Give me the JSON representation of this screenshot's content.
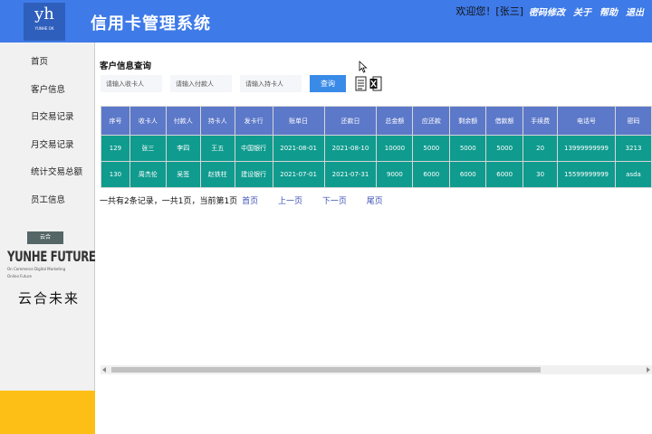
{
  "header": {
    "logo_text": "yh",
    "logo_sub": "YUNHE OK",
    "title": "信用卡管理系统",
    "welcome": "欢迎您！[张三]",
    "links": [
      "密码修改",
      "关于",
      "帮助",
      "退出"
    ]
  },
  "sidebar": {
    "items": [
      {
        "label": "首页"
      },
      {
        "label": "客户信息"
      },
      {
        "label": "日交易记录"
      },
      {
        "label": "月交易记录"
      },
      {
        "label": "统计交易总额"
      },
      {
        "label": "员工信息"
      }
    ],
    "brand": {
      "tag": "云合",
      "en": "YUNHE FUTURE",
      "line1": "On Commerce Digital Marketing",
      "line2": "Online Future",
      "cn": "云合未来"
    },
    "footer_color": "#fdbf16"
  },
  "main": {
    "title": "客户信息查询",
    "search": {
      "payee_placeholder": "请输入收卡人",
      "payer_placeholder": "请输入付款人",
      "holder_placeholder": "请输入持卡人",
      "button": "查询"
    },
    "table": {
      "headers": [
        "序号",
        "收卡人",
        "付款人",
        "持卡人",
        "发卡行",
        "账单日",
        "还款日",
        "总金额",
        "应还款",
        "剩余额",
        "借款额",
        "手续费",
        "电话号",
        "密码"
      ],
      "rows": [
        [
          "129",
          "张三",
          "李四",
          "王五",
          "中国银行",
          "2021-08-01",
          "2021-08-10",
          "10000",
          "5000",
          "5000",
          "5000",
          "20",
          "13999999999",
          "3213"
        ],
        [
          "130",
          "周杰伦",
          "吴签",
          "赵铁柱",
          "建设银行",
          "2021-07-01",
          "2021-07-31",
          "9000",
          "6000",
          "6000",
          "6000",
          "30",
          "15599999999",
          "asda"
        ]
      ]
    },
    "pager": {
      "summary": "一共有2条记录，一共1页，当前第1页",
      "first": "首页",
      "prev": "上一页",
      "next": "下一页",
      "last": "尾页"
    }
  },
  "colors": {
    "header_bg": "#3e7ae8",
    "table_header_bg": "#5c78c9",
    "table_row_bg": "#0f9b8e",
    "button_bg": "#3a8be8"
  }
}
